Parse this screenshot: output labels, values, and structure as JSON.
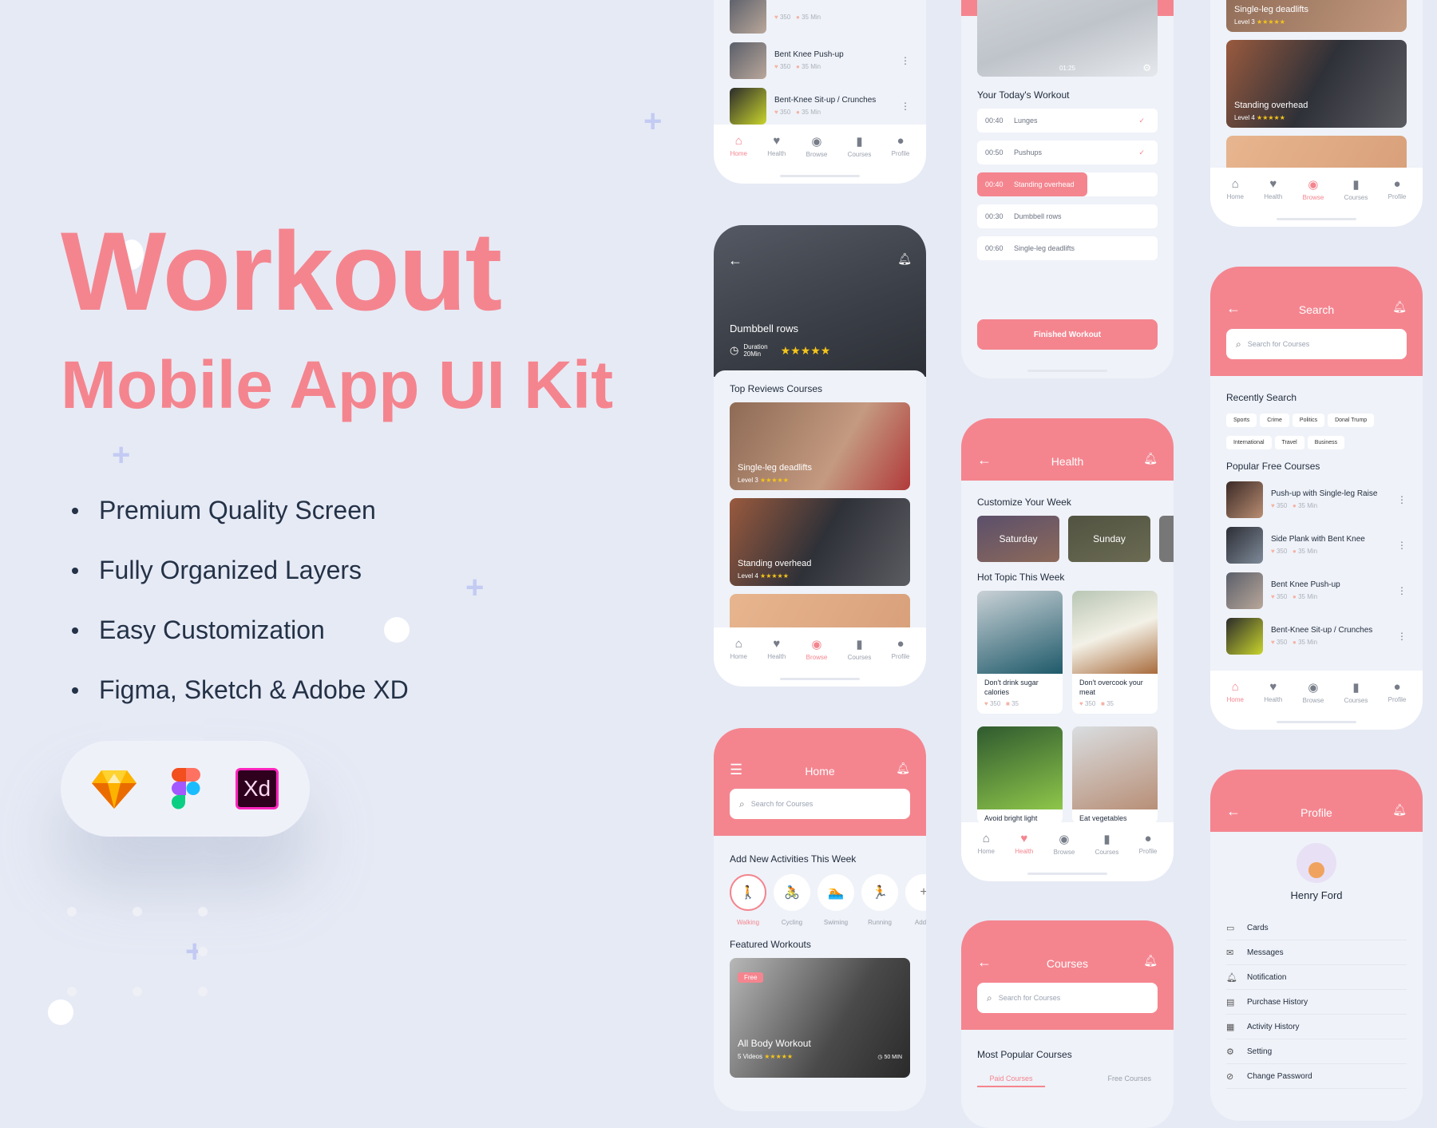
{
  "hero": {
    "title": "Workout",
    "subtitle": "Mobile App UI Kit",
    "features": [
      "Premium Quality Screen",
      "Fully Organized Layers",
      "Easy Customization",
      "Figma, Sketch & Adobe XD"
    ],
    "tools": [
      {
        "name": "sketch-icon"
      },
      {
        "name": "figma-icon"
      },
      {
        "name": "xd-icon",
        "label": "Xd"
      }
    ]
  },
  "colors": {
    "accent": "#f4858f",
    "background": "#e6eaf5",
    "text": "#243247"
  },
  "nav": {
    "items": [
      "Home",
      "Health",
      "Browse",
      "Courses",
      "Profile"
    ]
  },
  "common": {
    "search_placeholder": "Search for Courses",
    "likes": "350",
    "duration": "35 Min",
    "comments": "35"
  },
  "list_screen": {
    "items": [
      {
        "name": ""
      },
      {
        "name": "Bent Knee Push-up"
      },
      {
        "name": "Bent-Knee Sit-up / Crunches"
      },
      {
        "name": "Bent Knee Push-up"
      }
    ],
    "active_nav": "Home"
  },
  "workout_screen": {
    "video_time": "01:25",
    "title": "Your Today's Workout",
    "items": [
      {
        "time": "00:40",
        "name": "Lunges",
        "done": true
      },
      {
        "time": "00:50",
        "name": "Pushups",
        "done": true
      },
      {
        "time": "00:40",
        "name": "Standing overhead",
        "active": true
      },
      {
        "time": "00:30",
        "name": "Dumbbell rows"
      },
      {
        "time": "00:60",
        "name": "Single-leg deadlifts"
      }
    ],
    "button": "Finished Workout"
  },
  "browse_top_screen": {
    "cards": [
      {
        "title": "Single-leg deadlifts",
        "level": "Level 3",
        "stars": "★★★★★"
      },
      {
        "title": "Standing overhead",
        "level": "Level 4",
        "stars": "★★★★★"
      }
    ],
    "active_nav": "Browse"
  },
  "detail_screen": {
    "title": "Dumbbell rows",
    "duration_label": "Duration",
    "duration_value": "20Min",
    "stars": "★★★★★",
    "section": "Top Reviews Courses",
    "cards": [
      {
        "title": "Single-leg deadlifts",
        "level": "Level 3",
        "stars": "★★★★★"
      },
      {
        "title": "Standing overhead",
        "level": "Level 4",
        "stars": "★★★★★"
      }
    ],
    "active_nav": "Browse"
  },
  "search_screen": {
    "title": "Search",
    "recent_label": "Recently Search",
    "tags": [
      "Sports",
      "Crime",
      "Politics",
      "Donal Trump",
      "International",
      "Travel",
      "Business"
    ],
    "popular_label": "Popular Free Courses",
    "items": [
      {
        "name": "Push-up with Single-leg Raise"
      },
      {
        "name": "Side Plank with Bent Knee"
      },
      {
        "name": "Bent Knee Push-up"
      },
      {
        "name": "Bent-Knee Sit-up / Crunches"
      },
      {
        "name": "Bent Knee Push-up"
      }
    ],
    "active_nav": "Home"
  },
  "health_screen": {
    "title": "Health",
    "week_label": "Customize Your Week",
    "days": [
      "Saturday",
      "Sunday"
    ],
    "hot_label": "Hot Topic This Week",
    "topics": [
      {
        "title": "Don't drink sugar calories"
      },
      {
        "title": "Don't overcook your meat"
      },
      {
        "title": "Avoid bright light"
      },
      {
        "title": "Eat vegetables"
      }
    ],
    "active_nav": "Health"
  },
  "home_screen": {
    "title": "Home",
    "activities_label": "Add New Activities This Week",
    "activities": [
      {
        "label": "Walking",
        "icon": "🚶"
      },
      {
        "label": "Cycling",
        "icon": "🚴"
      },
      {
        "label": "Swiming",
        "icon": "🏊"
      },
      {
        "label": "Running",
        "icon": "🏃"
      },
      {
        "label": "Add N",
        "icon": "+"
      }
    ],
    "featured_label": "Featured Workouts",
    "featured": {
      "badge": "Free",
      "title": "All Body Workout",
      "videos": "5 Videos",
      "stars": "★★★★★",
      "time": "50 MIN"
    }
  },
  "courses_screen": {
    "title": "Courses",
    "popular_label": "Most Popular Courses",
    "tabs": [
      "Paid Courses",
      "Free Courses"
    ]
  },
  "profile_screen": {
    "title": "Profile",
    "name": "Henry Ford",
    "items": [
      "Cards",
      "Messages",
      "Notification",
      "Purchase History",
      "Activity History",
      "Setting",
      "Change Password"
    ]
  }
}
